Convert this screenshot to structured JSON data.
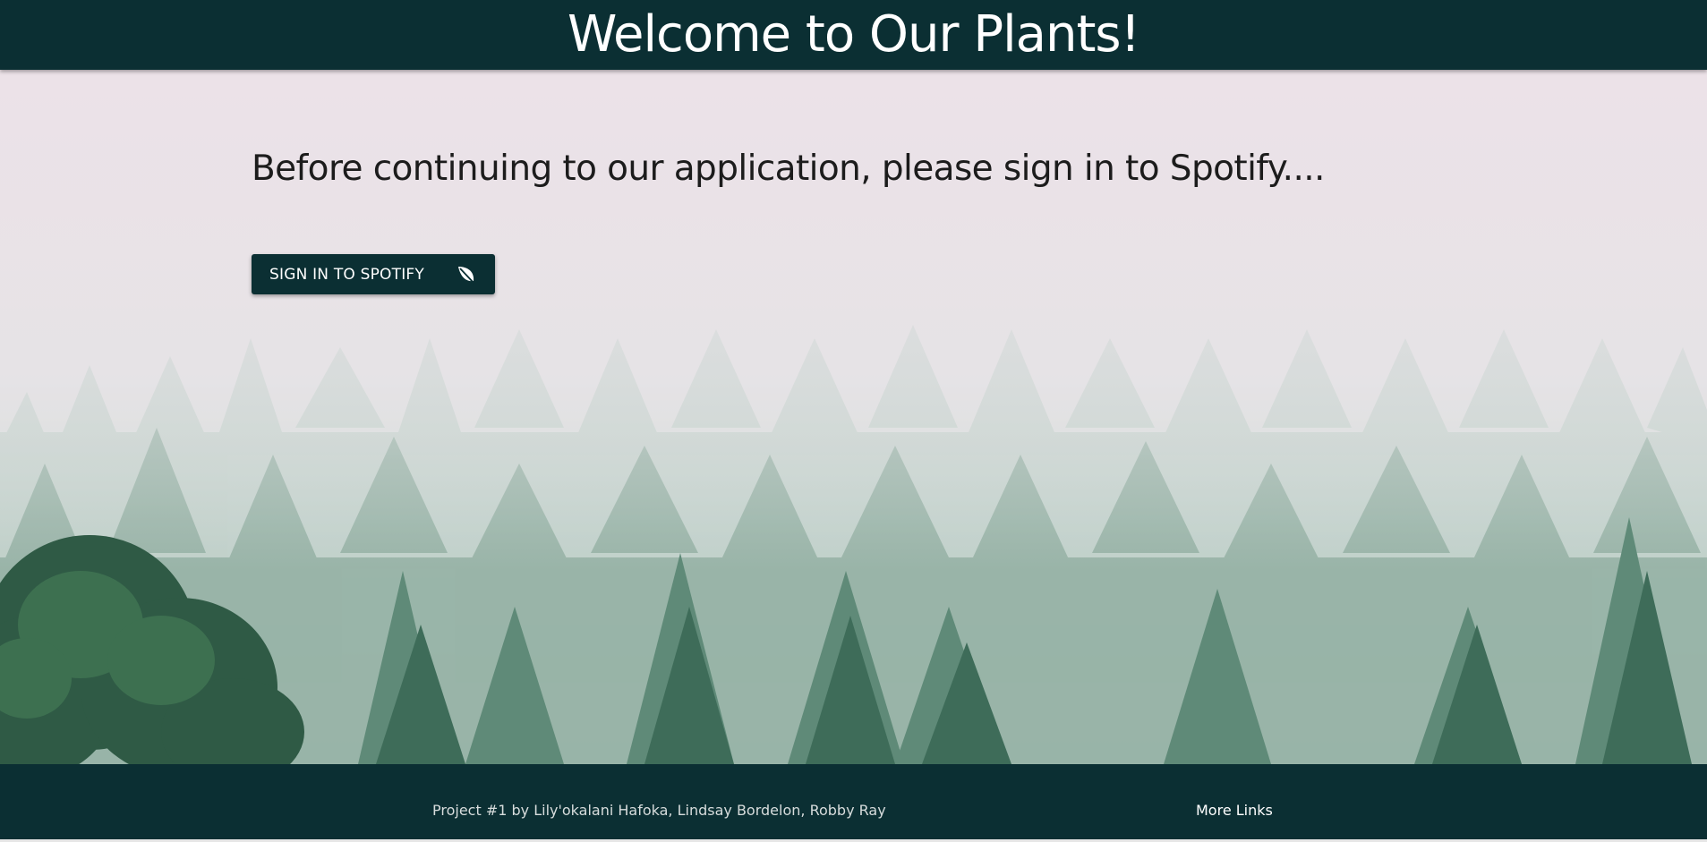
{
  "header": {
    "title": "Welcome to Our Plants!"
  },
  "main": {
    "prompt": "Before continuing to our application, please sign in to Spotify....",
    "signin_button_label": "SIGN IN TO SPOTIFY",
    "signin_button_icon": "leaf-icon"
  },
  "footer": {
    "credit": "Project #1 by Lily'okalani Hafoka, Lindsay Bordelon, Robby Ray",
    "links_label": "More Links"
  },
  "colors": {
    "bar": "#0b2f33",
    "text_light": "#ffffff",
    "text_dark": "#1c1c1c",
    "sky": "#ede1e8",
    "forest_dark": "#2f5a45"
  }
}
